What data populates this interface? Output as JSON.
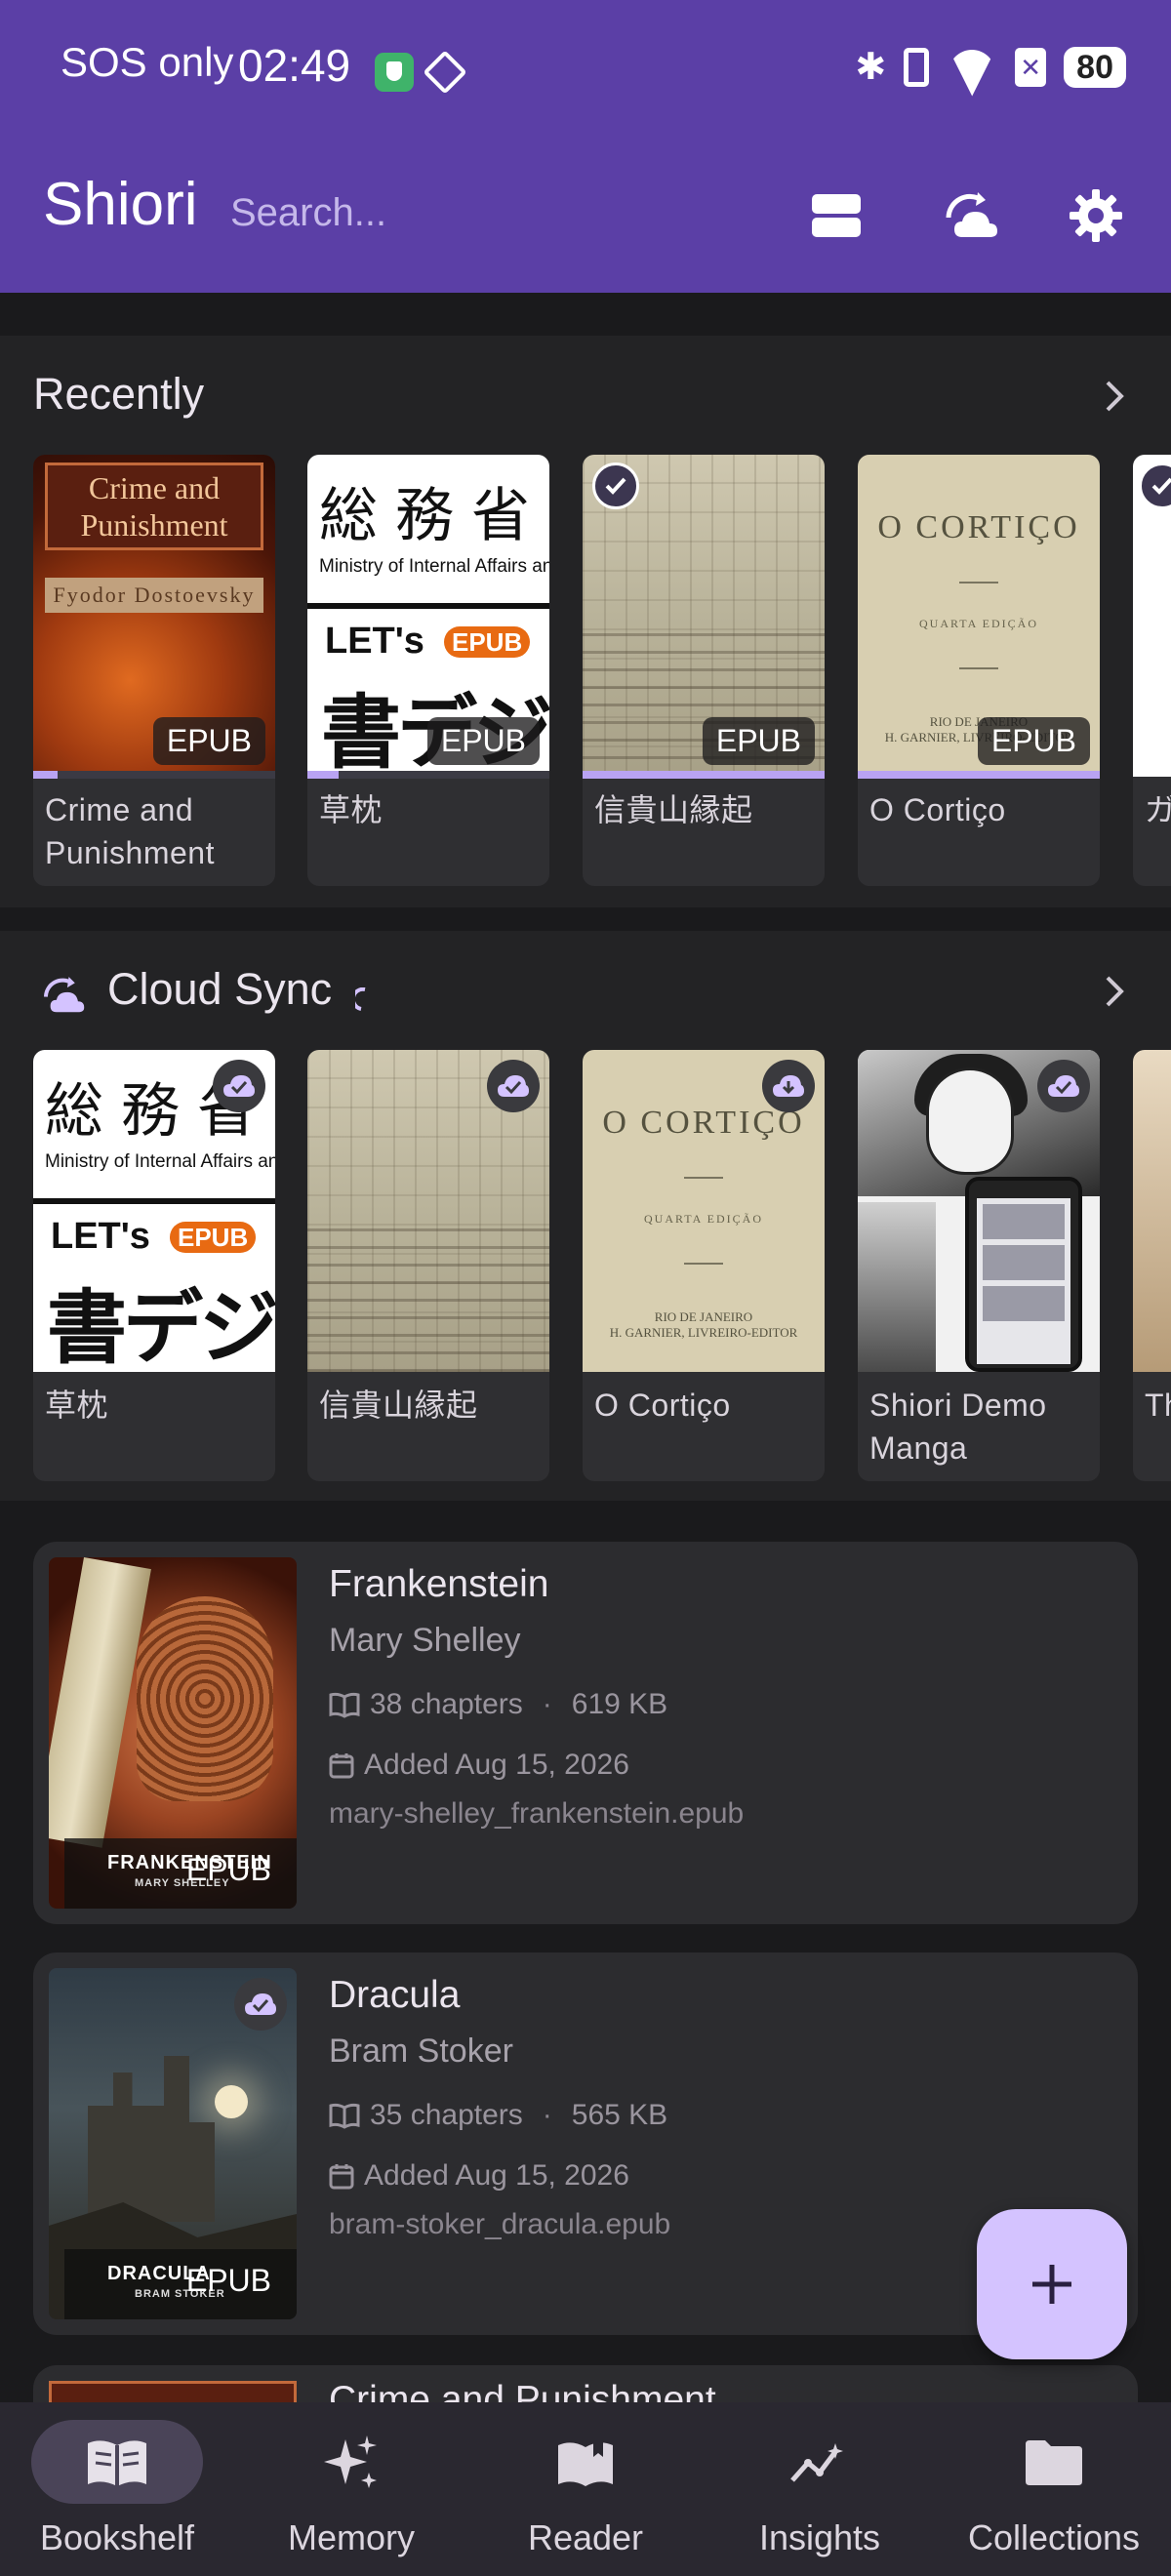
{
  "status_bar": {
    "carrier": "SOS only",
    "time": "02:49",
    "battery": "80"
  },
  "app_bar": {
    "title": "Shiori",
    "search_placeholder": "Search..."
  },
  "recently": {
    "title": "Recently",
    "books": [
      {
        "title": "Crime and Punishment",
        "format": "EPUB",
        "progress": 0.1,
        "cover": {
          "title": "Crime and Punishment",
          "author": "Fyodor Dostoevsky"
        }
      },
      {
        "title": "草枕",
        "format": "EPUB",
        "progress": 0.13,
        "cover": {
          "kanji": "総務省",
          "en": "Ministry of Internal Affairs and Communications",
          "lets": "LET's",
          "epub": "EPUB",
          "big": "書デジ"
        }
      },
      {
        "title": "信貴山縁起",
        "format": "EPUB",
        "progress": 1.0,
        "synced": true
      },
      {
        "title": "O Cortiço",
        "format": "EPUB",
        "progress": 1.0,
        "cover": {
          "title": "O CORTIÇO",
          "edition": "QUARTA EDIÇÃO",
          "place": "RIO DE JANEIRO",
          "publisher": "H. GARNIER, LIVREIRO-EDITOR"
        }
      },
      {
        "title": "ガ",
        "synced": true
      }
    ]
  },
  "cloud_sync": {
    "title": "Cloud Sync",
    "books": [
      {
        "title": "草枕",
        "status": "synced"
      },
      {
        "title": "信貴山縁起",
        "status": "synced"
      },
      {
        "title": "O Cortiço",
        "status": "download"
      },
      {
        "title": "Shiori Demo Manga",
        "status": "synced"
      },
      {
        "title": "Th De"
      }
    ]
  },
  "library": [
    {
      "title": "Frankenstein",
      "author": "Mary Shelley",
      "chapters": "38 chapters",
      "size": "619 KB",
      "added": "Added Aug 15, 2026",
      "file": "mary-shelley_frankenstein.epub",
      "format": "EPUB",
      "cover_title": "FRANKENSTEIN",
      "cover_author": "MARY SHELLEY"
    },
    {
      "title": "Dracula",
      "author": "Bram Stoker",
      "chapters": "35 chapters",
      "size": "565 KB",
      "added": "Added Aug 15, 2026",
      "file": "bram-stoker_dracula.epub",
      "format": "EPUB",
      "synced": true,
      "cover_title": "DRACULA",
      "cover_author": "BRAM STOKER"
    },
    {
      "title": "Crime and Punishment"
    }
  ],
  "bottom_nav": [
    {
      "label": "Bookshelf",
      "icon": "book-open-icon",
      "active": true
    },
    {
      "label": "Memory",
      "icon": "sparkles-icon",
      "active": false
    },
    {
      "label": "Reader",
      "icon": "reader-book-icon",
      "active": false
    },
    {
      "label": "Insights",
      "icon": "trend-chart-icon",
      "active": false
    },
    {
      "label": "Collections",
      "icon": "folder-icon",
      "active": false
    }
  ],
  "colors": {
    "app_bar": "#5b3fa6",
    "background": "#1a1a1c",
    "accent": "#b9a3f3",
    "fab": "#d4c3ff"
  }
}
